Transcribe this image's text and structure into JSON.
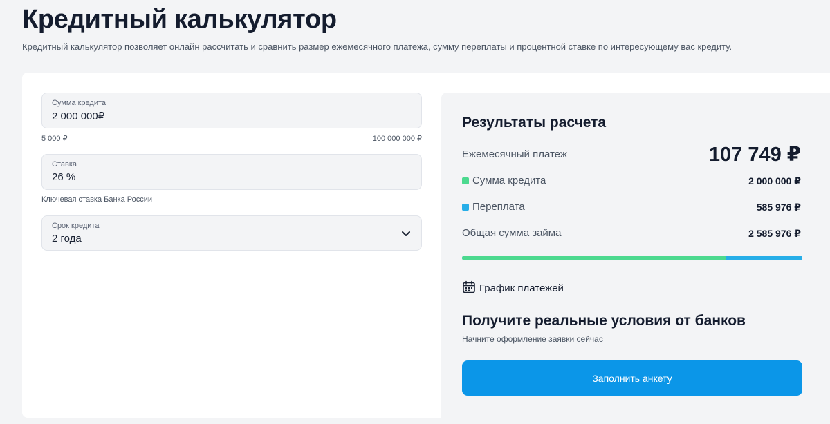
{
  "header": {
    "title": "Кредитный калькулятор",
    "description": "Кредитный калькулятор позволяет онлайн рассчитать и сравнить размер ежемесячного платежа, сумму переплаты и процентной ставке по интересующему вас кредиту."
  },
  "form": {
    "amount": {
      "label": "Сумма кредита",
      "value": "2 000 000₽",
      "min_hint": "5 000 ₽",
      "max_hint": "100 000 000 ₽"
    },
    "rate": {
      "label": "Ставка",
      "value": "26 %",
      "hint": "Ключевая ставка Банка России"
    },
    "term": {
      "label": "Срок кредита",
      "value": "2 года",
      "icon": "chevron-down-icon"
    }
  },
  "results": {
    "title": "Результаты расчета",
    "monthly_label": "Ежемесячный платеж",
    "monthly_value": "107 749 ₽",
    "principal_label": "Сумма кредита",
    "principal_value": "2 000 000 ₽",
    "overpay_label": "Переплата",
    "overpay_value": "585 976 ₽",
    "total_label": "Общая сумма займа",
    "total_value": "2 585 976 ₽",
    "principal_share": 0.7734,
    "schedule_label": "График платежей",
    "schedule_icon": "calendar-icon",
    "colors": {
      "principal": "#4cd98f",
      "overpay": "#27aee8",
      "button": "#0b96e8"
    }
  },
  "cta": {
    "title": "Получите реальные условия от банков",
    "subtitle": "Начните оформление заявки сейчас",
    "button_label": "Заполнить анкету"
  }
}
